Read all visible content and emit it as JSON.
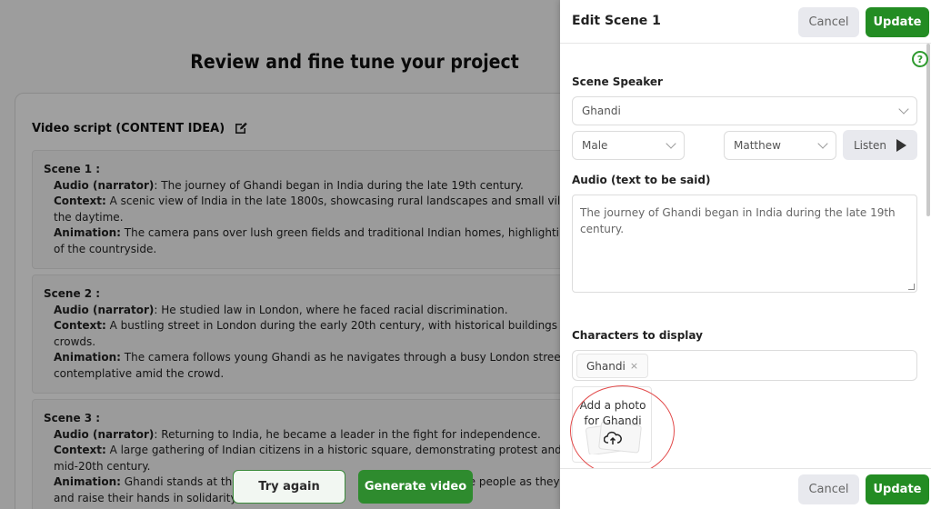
{
  "page": {
    "title": "Review and fine tune your project",
    "script_heading": "Video script (CONTENT IDEA)",
    "scenes": [
      {
        "title": "Scene 1 :",
        "audio_label": "Audio (narrator)",
        "audio": ": The journey of Ghandi began in India during the late 19th century.",
        "context_label": "Context:",
        "context": " A scenic view of India in the late 1800s, showcasing rural landscapes and small villages",
        "context_cont": "the daytime.",
        "animation_label": "Animation:",
        "animation": " The camera pans over lush green fields and traditional Indian homes, highlighting th",
        "animation_cont": "of the countryside."
      },
      {
        "title": "Scene 2 :",
        "audio_label": "Audio (narrator)",
        "audio": ": He studied law in London, where he faced racial discrimination.",
        "context_label": "Context:",
        "context": " A bustling street in London during the early 20th century, with historical buildings and di",
        "context_cont": "crowds.",
        "animation_label": "Animation:",
        "animation": " The camera follows young Ghandi as he navigates through a busy London street, loo",
        "animation_cont": "contemplative amid the crowd."
      },
      {
        "title": "Scene 3 :",
        "audio_label": "Audio (narrator)",
        "audio": ": Returning to India, he became a leader in the fight for independence.",
        "context_label": "Context:",
        "context": " A large gathering of Indian citizens in a historic square, demonstrating protest and unity",
        "context_cont": "mid-20th century.",
        "animation_label": "Animation:",
        "animation": " Ghandi stands at the f",
        "animation_tail": "e people as they",
        "animation_cont": "and raise their hands in solidarity."
      }
    ],
    "try_again": "Try again",
    "generate_video": "Generate video"
  },
  "panel": {
    "title": "Edit Scene 1",
    "cancel": "Cancel",
    "update": "Update",
    "help": "?",
    "speaker_label": "Scene Speaker",
    "speaker_value": "Ghandi",
    "gender_value": "Male",
    "voice_value": "Matthew",
    "listen": "Listen",
    "audio_label": "Audio (text to be said)",
    "audio_text": "The journey of Ghandi began in India during the late 19th century.",
    "characters_label": "Characters to display",
    "character_chip": "Ghandi",
    "chip_remove": "×",
    "add_photo_line1": "Add a photo",
    "add_photo_line2": "for Ghandi"
  },
  "colors": {
    "accent_green": "#238c23",
    "annotation_red": "#e24a4a"
  },
  "icons": [
    "edit-icon",
    "help-icon",
    "chevron-down-icon",
    "play-icon",
    "upload-cloud-icon",
    "close-icon"
  ]
}
